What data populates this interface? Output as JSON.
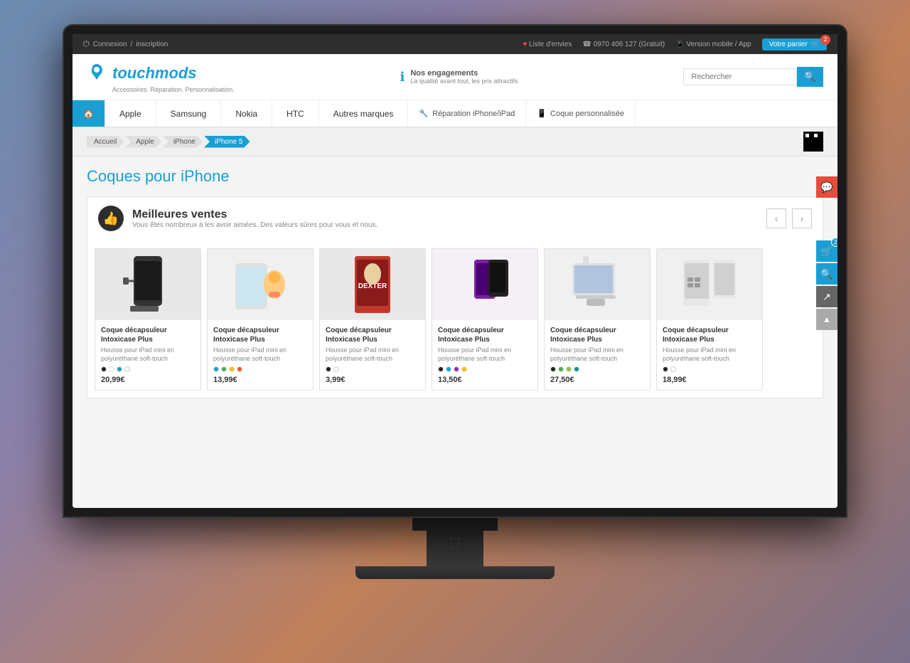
{
  "background": {
    "gradient": "mountain sunset"
  },
  "topbar": {
    "connexion_label": "Connexion",
    "separator": "/",
    "inscription_label": "inscription",
    "wishlist_label": "Liste d'envies",
    "phone_label": "0970 406 127 (Gratuit)",
    "mobile_label": "Version mobile",
    "app_label": "App",
    "cart_label": "Votre panier",
    "cart_count": "2"
  },
  "header": {
    "logo_text": "touchmods",
    "tagline": "Accessoires. Réparation. Personnalisation.",
    "engagement_title": "Nos engagements",
    "engagement_subtitle": "La qualité avant tout, les prix attractifs",
    "search_placeholder": "Rechercher"
  },
  "nav": {
    "items": [
      {
        "label": "🏠",
        "id": "home",
        "type": "home"
      },
      {
        "label": "Apple",
        "id": "apple"
      },
      {
        "label": "Samsung",
        "id": "samsung"
      },
      {
        "label": "Nokia",
        "id": "nokia"
      },
      {
        "label": "HTC",
        "id": "htc"
      },
      {
        "label": "Autres marques",
        "id": "autres"
      },
      {
        "label": "Réparation iPhone/iPad",
        "id": "reparation",
        "icon": "wrench"
      },
      {
        "label": "Coque personnalisée",
        "id": "coque",
        "icon": "phone"
      }
    ]
  },
  "breadcrumb": {
    "items": [
      {
        "label": "Accueil",
        "active": false
      },
      {
        "label": "Apple",
        "active": false
      },
      {
        "label": "iPhone",
        "active": false
      },
      {
        "label": "iPhone 5",
        "active": true
      }
    ]
  },
  "page": {
    "title": "Coques pour iPhone"
  },
  "bestsellers": {
    "section_title": "Meilleures ventes",
    "section_subtitle": "Vous êtes nombreux à les avoir aimées. Des valeurs sûres pour vous et nous.",
    "products": [
      {
        "id": 1,
        "name": "Coque décapsuleur Intoxicase Plus",
        "description": "Housse pour iPad mini en polyuréthane soft-touch",
        "price": "20,99€",
        "colors": [
          "#222",
          "#fff",
          "#1a9fd4",
          "#fff"
        ],
        "img_type": "phone_case_dark"
      },
      {
        "id": 2,
        "name": "Coque décapsuleur Intoxicase Plus",
        "description": "Housse pour iPad mini en polyuréthane soft-touch",
        "price": "13,99€",
        "colors": [
          "#1a9fd4",
          "#4CAF50",
          "#FFC107",
          "#FF5722"
        ],
        "img_type": "samsung_ad"
      },
      {
        "id": 3,
        "name": "Coque décapsuleur Intoxicase Plus",
        "description": "Housse pour iPad mini en polyuréthane soft-touch",
        "price": "3,99€",
        "colors": [
          "#222",
          "#fff"
        ],
        "img_type": "dexter"
      },
      {
        "id": 4,
        "name": "Coque décapsuleur Intoxicase Plus",
        "description": "Housse pour iPad mini en polyuréthane soft-touch",
        "price": "13,50€",
        "colors": [
          "#222",
          "#1a9fd4",
          "#9C27B0",
          "#FFC107"
        ],
        "img_type": "purple_case"
      },
      {
        "id": 5,
        "name": "Coque décapsuleur Intoxicase Plus",
        "description": "Housse pour iPad mini en polyuréthane soft-touch",
        "price": "27,50€",
        "colors": [
          "#222",
          "#4CAF50",
          "#8BC34A",
          "#009688"
        ],
        "img_type": "ipad_stand"
      },
      {
        "id": 6,
        "name": "Coque décapsuleur Intoxicase Plus",
        "description": "Housse pour iPad mini en polyuréthane soft-touch",
        "price": "18,99€",
        "colors": [
          "#222",
          "#fff"
        ],
        "img_type": "gameboy_case"
      }
    ]
  },
  "right_buttons": [
    {
      "icon": "💬",
      "color": "red",
      "label": "chat"
    },
    {
      "icon": "🛒",
      "color": "blue",
      "badge": "2",
      "label": "cart"
    },
    {
      "icon": "🔍",
      "color": "blue",
      "label": "search"
    },
    {
      "icon": "↗",
      "color": "gray",
      "label": "share"
    },
    {
      "icon": "▲",
      "color": "light",
      "label": "top"
    }
  ]
}
